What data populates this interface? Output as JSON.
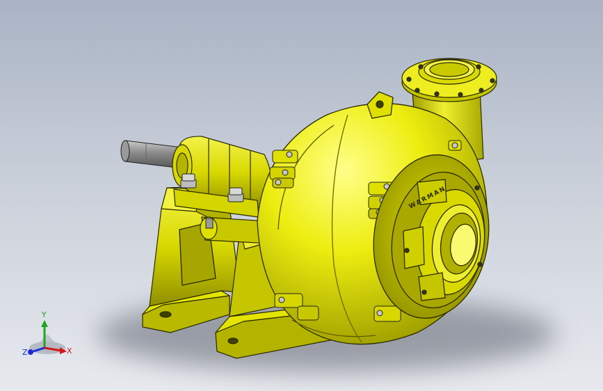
{
  "viewport": {
    "background_top": "#a9b3c4",
    "background_bottom": "#e7e9ee"
  },
  "model": {
    "body_color": "#e6e600",
    "shadow_color": "#e6e600",
    "edge_color": "#2a2a00",
    "shaft_color": "#8e8e8e",
    "bolt_color": "#bdbdbd",
    "casting_text": "WARMAN"
  },
  "triad": {
    "x_label": "X",
    "y_label": "Y",
    "z_label": "Z",
    "x_color": "#d01818",
    "y_color": "#1fa51f",
    "z_color": "#1a2bd6"
  }
}
